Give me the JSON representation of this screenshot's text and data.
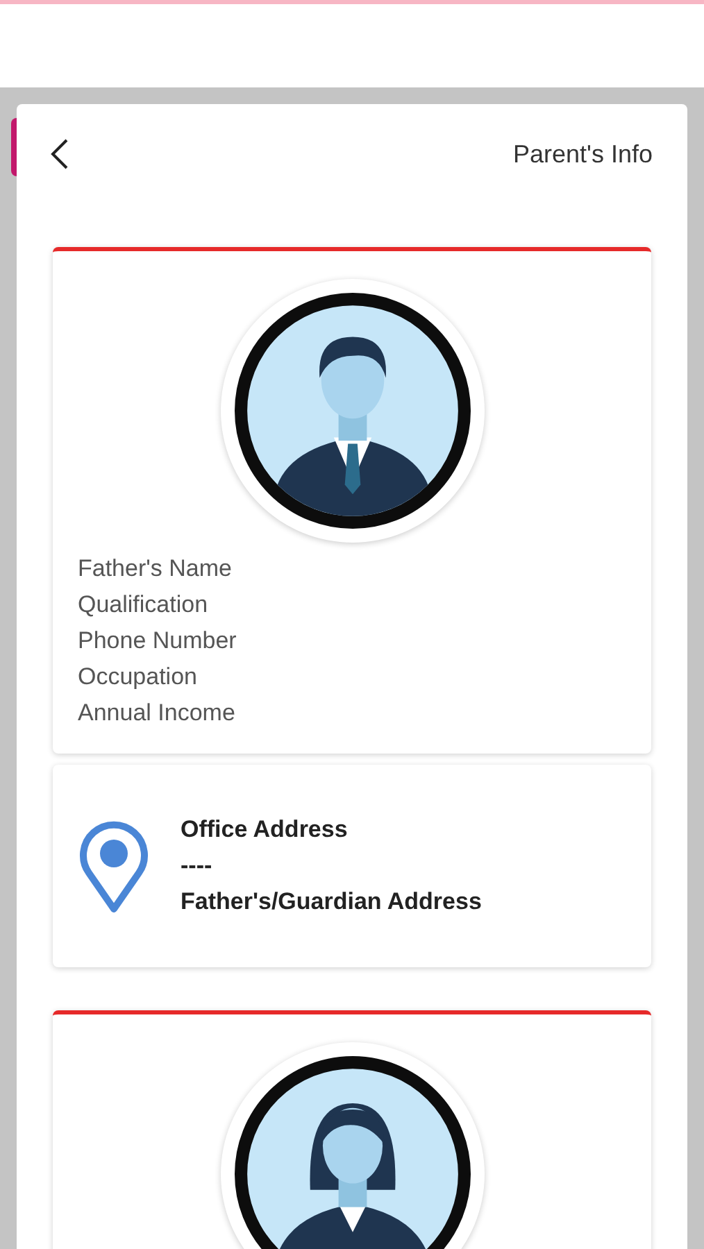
{
  "header": {
    "title": "Parent's Info"
  },
  "parents": [
    {
      "kind": "father",
      "fields": [
        "Father's Name",
        "Qualification",
        "Phone Number",
        "Occupation",
        "Annual Income"
      ],
      "address": {
        "title": "Office Address",
        "value": "----",
        "subtitle": "Father's/Guardian Address"
      }
    },
    {
      "kind": "mother"
    }
  ]
}
